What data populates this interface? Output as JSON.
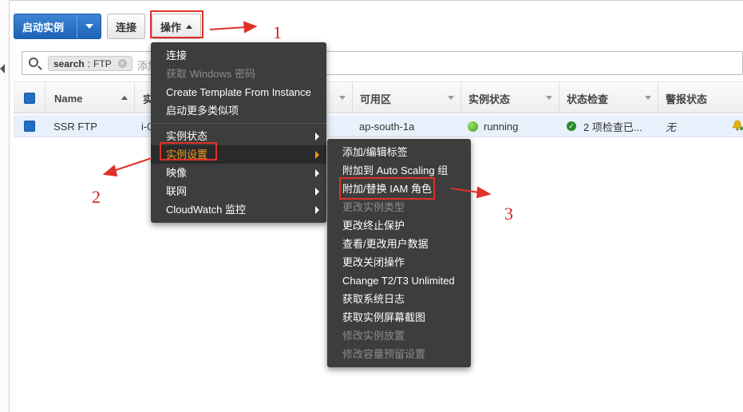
{
  "toolbar": {
    "launch_label": "启动实例",
    "connect_label": "连接",
    "actions_label": "操作"
  },
  "search": {
    "token_key": "search",
    "token_value": "FTP",
    "placeholder": "添加"
  },
  "table": {
    "columns": [
      "Name",
      "实",
      "可用区",
      "实例状态",
      "状态检查",
      "警报状态"
    ],
    "row": {
      "name": "SSR FTP",
      "instance_prefix": "i-0",
      "az": "ap-south-1a",
      "state": "running",
      "status_check": "2 项检查已...",
      "alarm": "无"
    }
  },
  "actions_menu": {
    "items": [
      {
        "label": "连接",
        "enabled": true
      },
      {
        "label": "获取 Windows 密码",
        "enabled": false
      },
      {
        "label": "Create Template From Instance",
        "enabled": true
      },
      {
        "label": "启动更多类似项",
        "enabled": true
      },
      {
        "label": "实例状态",
        "enabled": true,
        "submenu": true
      },
      {
        "label": "实例设置",
        "enabled": true,
        "submenu": true,
        "active": true
      },
      {
        "label": "映像",
        "enabled": true,
        "submenu": true
      },
      {
        "label": "联网",
        "enabled": true,
        "submenu": true
      },
      {
        "label": "CloudWatch 监控",
        "enabled": true,
        "submenu": true
      }
    ]
  },
  "settings_submenu": {
    "items": [
      {
        "label": "添加/编辑标签",
        "enabled": true
      },
      {
        "label": "附加到 Auto Scaling 组",
        "enabled": true
      },
      {
        "label": "附加/替换 IAM 角色",
        "enabled": true
      },
      {
        "label": "更改实例类型",
        "enabled": false
      },
      {
        "label": "更改终止保护",
        "enabled": true
      },
      {
        "label": "查看/更改用户数据",
        "enabled": true
      },
      {
        "label": "更改关闭操作",
        "enabled": true
      },
      {
        "label": "Change T2/T3 Unlimited",
        "enabled": true
      },
      {
        "label": "获取系统日志",
        "enabled": true
      },
      {
        "label": "获取实例屏幕截图",
        "enabled": true
      },
      {
        "label": "修改实例放置",
        "enabled": false
      },
      {
        "label": "修改容量预留设置",
        "enabled": false
      }
    ]
  },
  "annotations": {
    "n1": "1",
    "n2": "2",
    "n3": "3",
    "color": "#e0302a"
  }
}
